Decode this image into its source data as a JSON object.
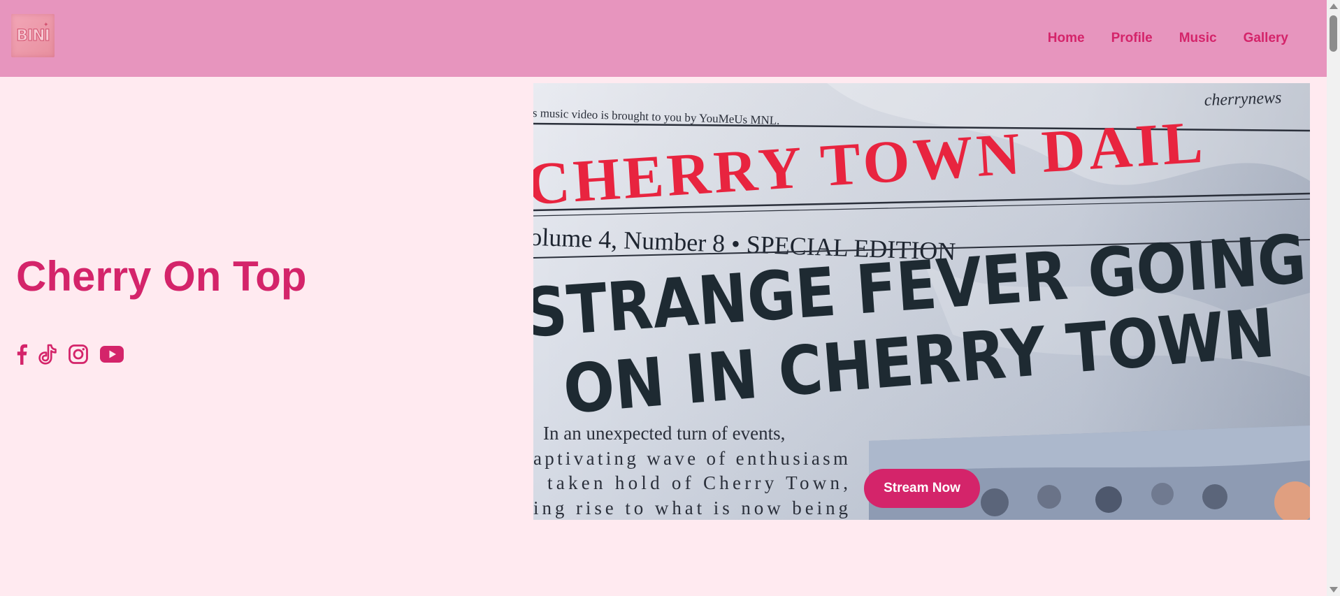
{
  "brand": {
    "logo_text": "BINI",
    "logo_star": "✦"
  },
  "nav": {
    "items": [
      {
        "label": "Home"
      },
      {
        "label": "Profile"
      },
      {
        "label": "Music"
      },
      {
        "label": "Gallery"
      }
    ]
  },
  "hero": {
    "title": "Cherry On Top",
    "cta_label": "Stream Now"
  },
  "socials": [
    {
      "icon": "facebook-icon"
    },
    {
      "icon": "tiktok-icon"
    },
    {
      "icon": "instagram-icon"
    },
    {
      "icon": "youtube-icon"
    }
  ],
  "video": {
    "caption": "is music video is brought to you by YouMeUs MNL.",
    "site": "cherrynews",
    "masthead": "CHERRY TOWN DAIL",
    "edition": "olume 4, Number 8 • SPECIAL EDITION",
    "headline_1": "STRANGE FEVER GOING",
    "headline_2": "ON IN CHERRY TOWN",
    "body_lines": [
      "In an unexpected turn of events,",
      "aptivating wave of enthusiasm",
      "taken hold of Cherry Town,",
      "ing rise to what is now being"
    ]
  },
  "colors": {
    "accent": "#d4246a",
    "header_bg": "#e795be",
    "page_bg": "#ffeaf0",
    "masthead_red": "#e8243f"
  }
}
